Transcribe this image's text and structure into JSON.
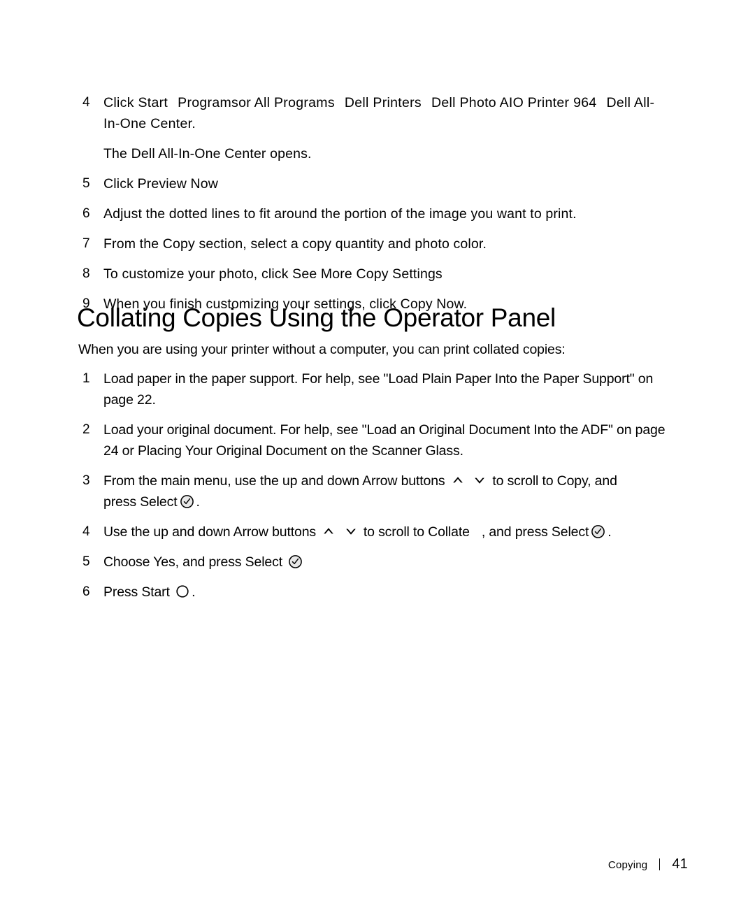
{
  "page": {
    "background_color": "#ffffff",
    "text_color": "#000000"
  },
  "list_a": {
    "steps": [
      {
        "number": "4",
        "prefix": "Click Start",
        "menu_path": [
          "Programs",
          "or All Programs",
          "Dell Printers",
          "Dell Photo AIO Printer 964",
          "Dell All-In-One Center"
        ],
        "line1_a": "Click Start",
        "line1_b": "Programs",
        "line1_c": "or All Programs",
        "line1_d": "Dell Printers",
        "line1_e": "Dell Photo AIO Printer",
        "line2_a": "964",
        "line2_b": "Dell All-In-One Center",
        "line2_end": "."
      },
      {
        "number": "5",
        "text": "Click Preview Now"
      },
      {
        "number": "6",
        "text": "Adjust the dotted lines to fit around the portion of the image you want to print."
      },
      {
        "number": "7",
        "text": "From the Copy section, select a copy quantity and photo color."
      },
      {
        "number": "8",
        "text": "To customize your photo, click See More Copy Settings"
      },
      {
        "number": "9",
        "text": "When you finish customizing your settings, click Copy Now."
      }
    ],
    "note": "The Dell All-In-One Center opens."
  },
  "heading": "Collating Copies Using the Operator Panel",
  "lead": "When you are using your printer without a computer, you can print collated copies:",
  "list_b": {
    "step1": {
      "number": "1",
      "text": "Load paper in the paper support. For help, see \"Load Plain Paper Into the Paper Support\" on page 22."
    },
    "step2": {
      "number": "2",
      "text": "Load your original document. For help, see \"Load an Original Document Into the ADF\" on page 24 or Placing Your Original Document on the Scanner Glass."
    },
    "step3": {
      "number": "3",
      "part1": "From the main menu, use the up and down Arrow buttons",
      "part2": "to scroll to Copy, and",
      "part3": "press Select",
      "part4": "."
    },
    "step4": {
      "number": "4",
      "part1": "Use the up and down Arrow buttons",
      "part2": "to scroll to Collate",
      "part3": ", and press Select",
      "part4": "."
    },
    "step5": {
      "number": "5",
      "part1": "Choose Yes, and press Select"
    },
    "step6": {
      "number": "6",
      "part1": "Press Start",
      "part2": "."
    }
  },
  "icons": {
    "arrow_up": "arrow-up-chevron-icon",
    "arrow_down": "arrow-down-chevron-icon",
    "select": "select-checkmark-circle-icon",
    "start": "start-circle-icon"
  },
  "footer": {
    "section": "Copying",
    "page_number": "41"
  }
}
